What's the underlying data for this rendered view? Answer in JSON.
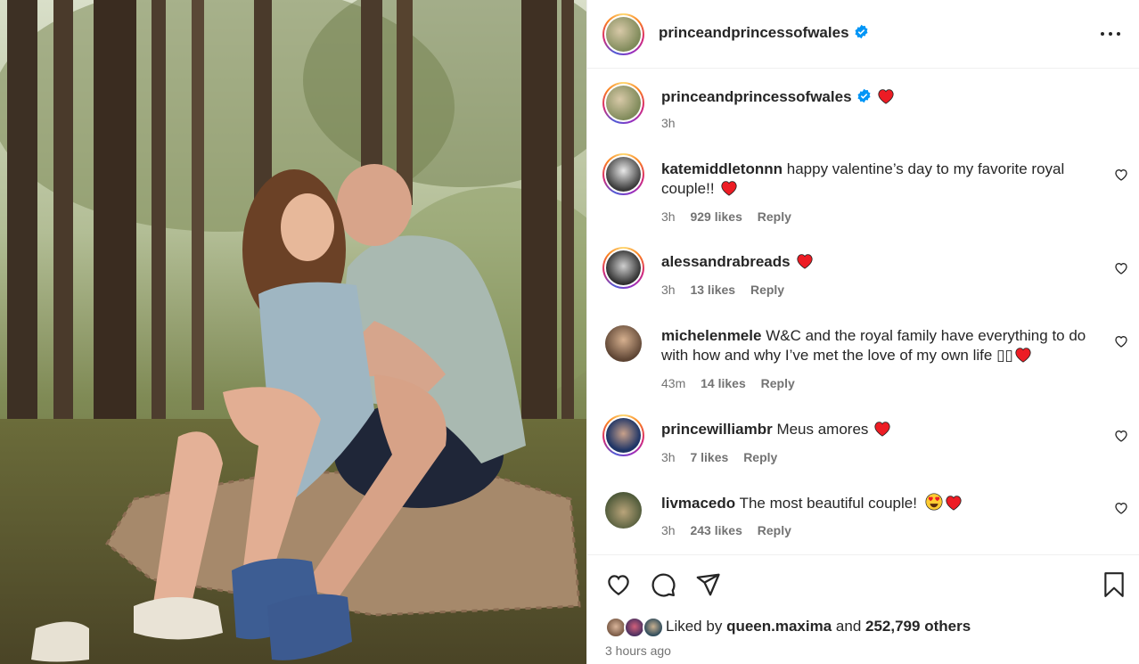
{
  "post": {
    "author": "princeandprincessofwales",
    "verified": true
  },
  "caption": {
    "author": "princeandprincessofwales",
    "time": "3h"
  },
  "comments": [
    {
      "username": "katemiddletonnn",
      "text": "happy valentine’s day to my favorite royal couple!!",
      "time": "3h",
      "likes": "929 likes",
      "reply": "Reply"
    },
    {
      "username": "alessandrabreads",
      "text": "",
      "time": "3h",
      "likes": "13 likes",
      "reply": "Reply"
    },
    {
      "username": "michelenmele",
      "text": "W&C and the royal family have everything to do with how and why I’ve met the love of my own life",
      "glyphs": "▯▯",
      "time": "43m",
      "likes": "14 likes",
      "reply": "Reply"
    },
    {
      "username": "princewilliambr",
      "text": "Meus amores",
      "time": "3h",
      "likes": "7 likes",
      "reply": "Reply"
    },
    {
      "username": "livmacedo",
      "text": "The most beautiful couple!",
      "time": "3h",
      "likes": "243 likes",
      "reply": "Reply"
    }
  ],
  "likes": {
    "prefix": "Liked by",
    "top_liker": "queen.maxima",
    "joiner": "and",
    "others": "252,799 others"
  },
  "posted_ago": "3 hours ago",
  "icons": {
    "more": "more-options-icon",
    "verified": "verified-badge-icon",
    "heart": "heart-emoji-icon",
    "like": "like-icon",
    "comment": "comment-icon",
    "share": "share-icon",
    "save": "save-bookmark-icon"
  },
  "colors": {
    "verified_blue": "#0095f6",
    "heart_red": "#ed1c24",
    "secondary_text": "#737373"
  }
}
